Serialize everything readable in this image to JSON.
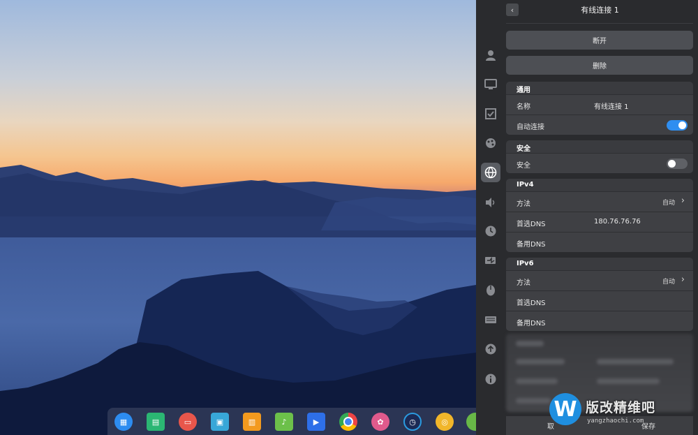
{
  "dock": {
    "apps": [
      {
        "name": "launcher",
        "color": "#2d8cf0",
        "glyph": "▦"
      },
      {
        "name": "file-manager",
        "color": "#2bb673",
        "glyph": "▤"
      },
      {
        "name": "screen-recorder",
        "color": "#e8564b",
        "glyph": "▭"
      },
      {
        "name": "app-store",
        "color": "#38a7d8",
        "glyph": "▣"
      },
      {
        "name": "deepin-store",
        "color": "#f39a1e",
        "glyph": "▥"
      },
      {
        "name": "music",
        "color": "#6cc04a",
        "glyph": "♪"
      },
      {
        "name": "video-player",
        "color": "#2e6fe8",
        "glyph": "▶"
      },
      {
        "name": "chrome",
        "color": "#e5b31a",
        "glyph": "◉"
      },
      {
        "name": "settings",
        "color": "#e05a8c",
        "glyph": "✿"
      },
      {
        "name": "clock",
        "color": "#2b9be0",
        "glyph": "◷"
      },
      {
        "name": "cpu-monitor",
        "color": "#f1b62a",
        "glyph": "◎"
      },
      {
        "name": "terminal",
        "color": "#68b847",
        "glyph": "●"
      }
    ]
  },
  "panel": {
    "title": "有线连接 1",
    "disconnect_label": "断开",
    "delete_label": "删除",
    "sections": {
      "general": {
        "title": "通用",
        "name_label": "名称",
        "name_value": "有线连接 1",
        "autoconnect_label": "自动连接",
        "autoconnect_on": true
      },
      "security": {
        "title": "安全",
        "security_label": "安全",
        "security_on": false
      },
      "ipv4": {
        "title": "IPv4",
        "method_label": "方法",
        "method_value": "自动",
        "dns1_label": "首选DNS",
        "dns1_value": "180.76.76.76",
        "dns2_label": "备用DNS"
      },
      "ipv6": {
        "title": "IPv6",
        "method_label": "方法",
        "method_value": "自动",
        "dns1_label": "首选DNS",
        "dns2_label": "备用DNS"
      }
    },
    "bottom": {
      "cancel_label": "取",
      "save_label": "保存"
    }
  },
  "watermark": {
    "logo": "W",
    "title": "版改精维吧",
    "sub": "yangzhaochi.com"
  },
  "colors": {
    "toggle_on": "#2f8ef0",
    "toggle_off": "#5f6166",
    "panel_bg": "#2a2b2e"
  }
}
